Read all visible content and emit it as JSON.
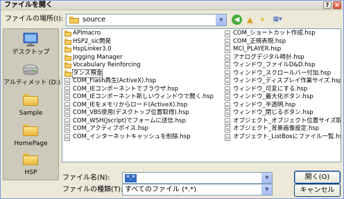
{
  "dialog": {
    "title": "ファイルを開く",
    "help_glyph": "?",
    "close_glyph": "×"
  },
  "look_in": {
    "label": "ファイルの場所(I):",
    "value": "source"
  },
  "toolbar": {
    "back_glyph": "◀",
    "up_glyph": "▲",
    "new_folder_glyph": "✦",
    "views_glyph": "▦▾"
  },
  "places": [
    {
      "label": "デスクトップ",
      "icon": "desktop-icon"
    },
    {
      "label": "アルティメット (D:)",
      "icon": "drive-icon"
    },
    {
      "label": "Sample",
      "icon": "folder-icon"
    },
    {
      "label": "HomePage",
      "icon": "folder-icon"
    },
    {
      "label": "HSP",
      "icon": "folder-icon"
    }
  ],
  "files": {
    "column1": [
      {
        "name": "APImacro",
        "type": "folder"
      },
      {
        "name": "HSP2_sic開発",
        "type": "folder"
      },
      {
        "name": "HspLinker3.0",
        "type": "folder"
      },
      {
        "name": "Jogging Manager",
        "type": "folder"
      },
      {
        "name": "Vocabulary Reinforcing",
        "type": "folder"
      },
      {
        "name": "タンス預金",
        "type": "folder",
        "selected": true
      },
      {
        "name": "COM_Flash再生(ActiveX).hsp",
        "type": "file"
      },
      {
        "name": "COM_IEコンポーネントでブラウザ.hsp",
        "type": "file"
      },
      {
        "name": "COM_IEコンポーネント新しいウィンドウで開く.hsp",
        "type": "file"
      },
      {
        "name": "COM_IEをメモリからロード(ActiveX).hsp",
        "type": "file"
      },
      {
        "name": "COM_VBS使用(デスクトップ位置取得).hsp",
        "type": "file"
      },
      {
        "name": "COM_WSH(Jscript)でフォームに送信.hsp",
        "type": "file"
      },
      {
        "name": "COM_アクティブポイス.hsp",
        "type": "file"
      },
      {
        "name": "COM_インターネットキャッシュを削除.hsp",
        "type": "file"
      }
    ],
    "column2": [
      {
        "name": "COM_ショートカット作成.hsp",
        "type": "file"
      },
      {
        "name": "COM_正規表現.hsp",
        "type": "file"
      },
      {
        "name": "MCI_PLAYER.hsp",
        "type": "file"
      },
      {
        "name": "アナログデジタル時計.hsp",
        "type": "file"
      },
      {
        "name": "ウィンドウ_ファイルD&D.hsp",
        "type": "file"
      },
      {
        "name": "ウィンドウ_スクロールバー付加.hsp",
        "type": "file"
      },
      {
        "name": "ウィンドウ_ディスプレイ作業サイズ.hsp",
        "type": "file"
      },
      {
        "name": "ウィンドウ_可変にする.hsp",
        "type": "file"
      },
      {
        "name": "ウィンドウ_最大化ボタン.hsp",
        "type": "file"
      },
      {
        "name": "ウィンドウ_半透明.hsp",
        "type": "file"
      },
      {
        "name": "ウィンドウ_閉じるボタン.hsp",
        "type": "file"
      },
      {
        "name": "オブジェクト_オブジェクト位置サイズ取得.hsp",
        "type": "file"
      },
      {
        "name": "オブジェクト_背景画像設定.hsp",
        "type": "file"
      },
      {
        "name": "オブジェクト_ListBoxにファイル一覧.hsp",
        "type": "file"
      }
    ]
  },
  "file_name": {
    "label": "ファイル名(N):",
    "value": "*.*"
  },
  "file_type": {
    "label": "ファイルの種類(T):",
    "value": "すべてのファイル (*.*)"
  },
  "buttons": {
    "open_label": "開く(O)",
    "cancel_label": "キャンセル"
  },
  "combo_arrow_glyph": "▼"
}
